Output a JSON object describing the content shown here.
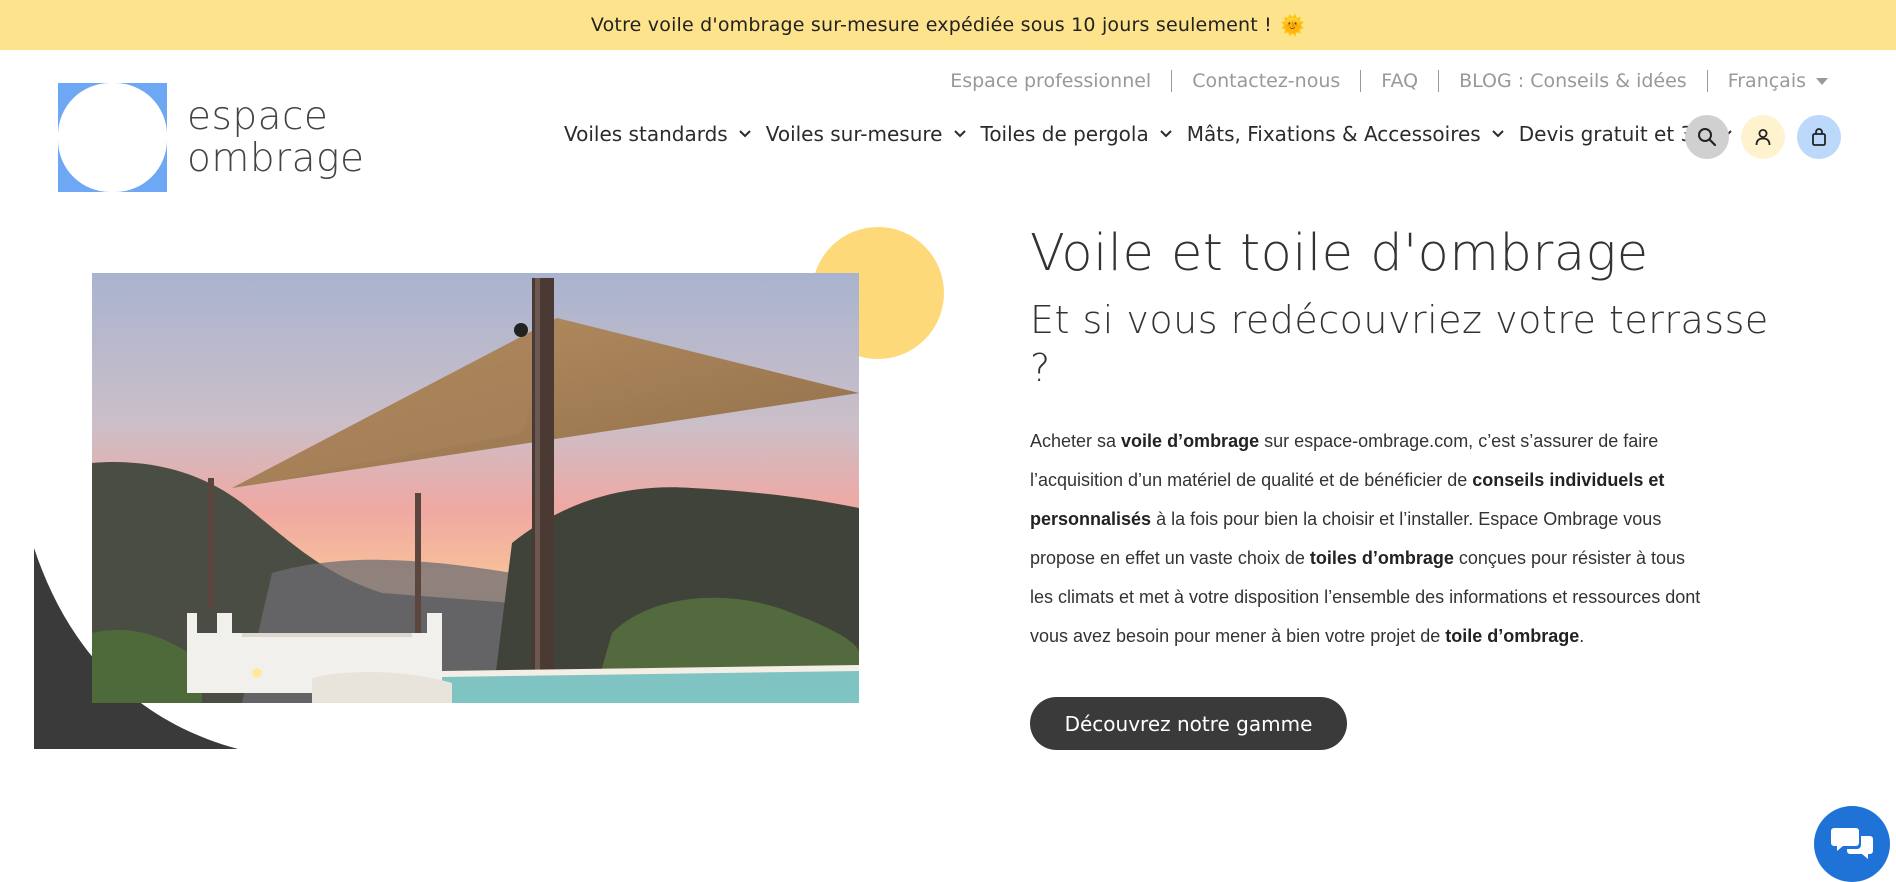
{
  "promo": {
    "text": "Votre voile d'ombrage sur-mesure expédiée sous 10 jours seulement !",
    "emoji": "🌞"
  },
  "logo": {
    "line1": "espace",
    "line2": "ombrage",
    "mark_color": "#6ea8f5"
  },
  "top_links": [
    {
      "label": "Espace professionnel"
    },
    {
      "label": "Contactez-nous"
    },
    {
      "label": "FAQ"
    },
    {
      "label": "BLOG : Conseils & idées"
    }
  ],
  "language": {
    "selected": "Français"
  },
  "main_nav": [
    {
      "label": "Voiles standards"
    },
    {
      "label": "Voiles sur-mesure"
    },
    {
      "label": "Toiles de pergola"
    },
    {
      "label": "Mâts, Fixations & Accessoires"
    },
    {
      "label": "Devis gratuit et 3D"
    }
  ],
  "nav_icons": {
    "search": "search-icon",
    "account": "user-icon",
    "cart": "bag-icon"
  },
  "hero": {
    "title": "Voile et toile d'ombrage",
    "subtitle": "Et si vous redécouvriez votre terrasse ?",
    "paragraph": {
      "p1": "Acheter sa ",
      "b1": "voile d’ombrage",
      "p2": " sur espace-ombrage.com, c’est s’assurer de faire l’acquisition d’un matériel de qualité et de bénéficier de ",
      "b2": "conseils individuels et personnalisés",
      "p3": " à la fois pour bien la choisir et l’installer. Espace Ombrage vous propose en effet un vaste choix de ",
      "b3": "toiles d’ombrage",
      "p4": " conçues pour résister à tous les climats et met à votre disposition l’ensemble des informations et ressources dont vous avez besoin pour mener à bien votre projet de ",
      "b4": "toile d’ombrage",
      "p5": "."
    },
    "cta_label": "Découvrez notre gamme"
  },
  "colors": {
    "promo_bg": "#fde38c",
    "accent_yellow": "#fdd97a",
    "dark": "#3a3a3a",
    "chat_blue": "#1f73d6",
    "logo_blue": "#6ea8f5"
  },
  "chat": {
    "icon": "chat-bubbles-icon"
  }
}
